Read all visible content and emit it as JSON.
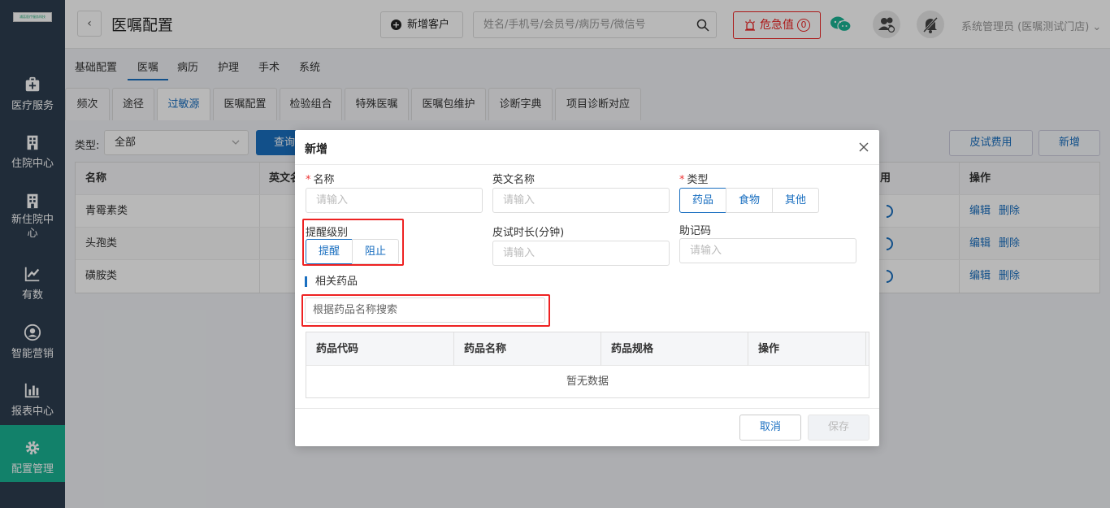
{
  "sidebar": {
    "logo_text": "浦蕊医疗服务科技",
    "items": [
      {
        "label": "医疗服务",
        "icon": "medical-kit-icon"
      },
      {
        "label": "住院中心",
        "icon": "hospital-building-icon"
      },
      {
        "label": "新住院中心",
        "icon": "new-hospital-building-icon"
      },
      {
        "label": "有数",
        "icon": "trend-chart-icon"
      },
      {
        "label": "智能营销",
        "icon": "marketing-user-icon"
      },
      {
        "label": "报表中心",
        "icon": "bar-chart-icon"
      },
      {
        "label": "配置管理",
        "icon": "gear-icon",
        "active": true
      }
    ]
  },
  "header": {
    "back_label": "‹",
    "title": "医嘱配置",
    "new_customer": "新增客户",
    "search_placeholder": "姓名/手机号/会员号/病历号/微信号",
    "critical_label": "危急值",
    "critical_count": "0",
    "user": "系统管理员 (医嘱测试门店)"
  },
  "tabs_primary": [
    "基础配置",
    "医嘱",
    "病历",
    "护理",
    "手术",
    "系统"
  ],
  "tabs_secondary": [
    "频次",
    "途径",
    "过敏源",
    "医嘱配置",
    "检验组合",
    "特殊医嘱",
    "医嘱包维护",
    "诊断字典",
    "项目诊断对应"
  ],
  "filter": {
    "type_label": "类型:",
    "type_value": "全部",
    "query_label": "查询",
    "skin_fee": "皮试费用",
    "add": "新增"
  },
  "main_table": {
    "headers": [
      "名称",
      "英文名",
      "用",
      "操作"
    ],
    "rows": [
      {
        "name": "青霉素类",
        "edit": "编辑",
        "delete": "删除"
      },
      {
        "name": "头孢类",
        "edit": "编辑",
        "delete": "删除"
      },
      {
        "name": "磺胺类",
        "edit": "编辑",
        "delete": "删除"
      }
    ]
  },
  "modal": {
    "title": "新增",
    "name_label": "名称",
    "name_placeholder": "请输入",
    "en_label": "英文名称",
    "en_placeholder": "请输入",
    "type_label": "类型",
    "type_options": [
      "药品",
      "食物",
      "其他"
    ],
    "remind_label": "提醒级别",
    "remind_options": [
      "提醒",
      "阻止"
    ],
    "skin_label": "皮试时长(分钟)",
    "skin_placeholder": "请输入",
    "mnemonic_label": "助记码",
    "mnemonic_placeholder": "请输入",
    "related_drugs": "相关药品",
    "drug_search_placeholder": "根据药品名称搜索",
    "drug_table_headers": [
      "药品代码",
      "药品名称",
      "药品规格",
      "操作"
    ],
    "empty_text": "暂无数据",
    "cancel": "取消",
    "save": "保存"
  },
  "colors": {
    "sidebar_bg": "#2d3e50",
    "accent": "#1a6fc0",
    "active_nav": "#1ab394",
    "danger": "#e22222"
  }
}
